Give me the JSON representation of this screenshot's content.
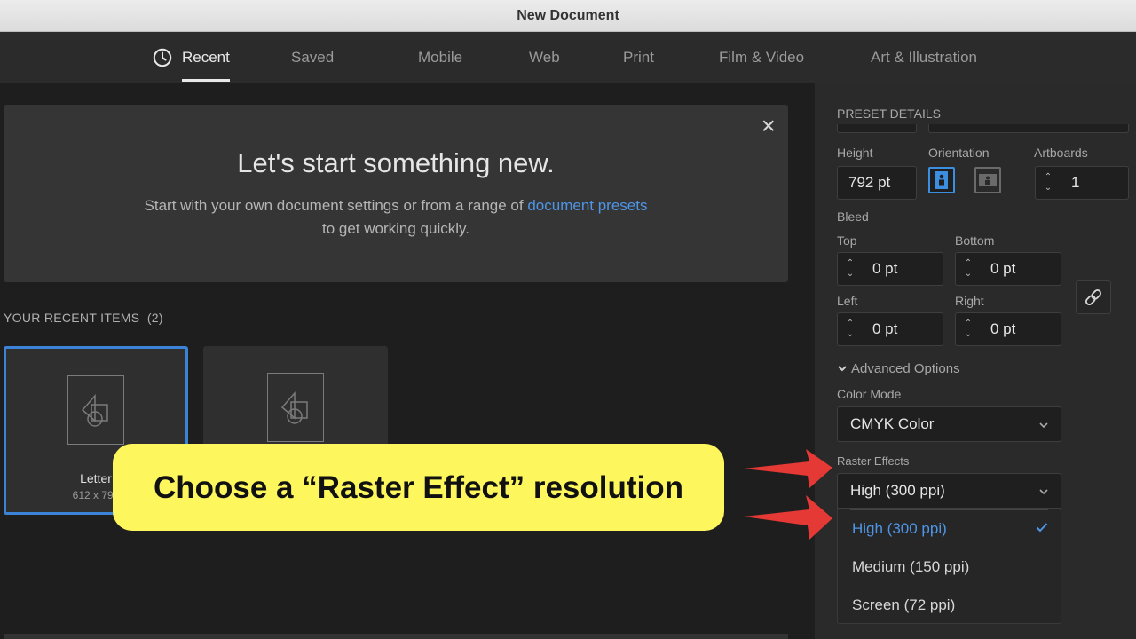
{
  "window": {
    "title": "New Document"
  },
  "tabs": [
    {
      "label": "Recent",
      "active": true,
      "icon": "clock-icon"
    },
    {
      "label": "Saved"
    },
    {
      "label": "Mobile"
    },
    {
      "label": "Web"
    },
    {
      "label": "Print"
    },
    {
      "label": "Film & Video"
    },
    {
      "label": "Art & Illustration"
    }
  ],
  "hero": {
    "title": "Let's start something new.",
    "subtitle_prefix": "Start with your own document settings or from a range of",
    "subtitle_link": "document presets",
    "subtitle_suffix": "to get working quickly.",
    "close_icon": "×"
  },
  "recent": {
    "title": "YOUR RECENT ITEMS",
    "count": "(2)",
    "items": [
      {
        "name": "Letter",
        "size": "612 x 792",
        "selected": true
      },
      {
        "name": "",
        "size": ""
      }
    ]
  },
  "preset": {
    "header": "PRESET DETAILS",
    "height_label": "Height",
    "height_value": "792 pt",
    "orientation_label": "Orientation",
    "artboards_label": "Artboards",
    "artboards_value": "1",
    "bleed_label": "Bleed",
    "top_label": "Top",
    "top_value": "0 pt",
    "bottom_label": "Bottom",
    "bottom_value": "0 pt",
    "left_label": "Left",
    "left_value": "0 pt",
    "right_label": "Right",
    "right_value": "0 pt",
    "advanced_label": "Advanced Options",
    "color_mode_label": "Color Mode",
    "color_mode_value": "CMYK Color",
    "raster_label": "Raster Effects",
    "raster_value": "High (300 ppi)",
    "raster_options": [
      "High (300 ppi)",
      "Medium (150 ppi)",
      "Screen (72 ppi)"
    ],
    "raster_selected": "High (300 ppi)"
  },
  "callout": {
    "text": "Choose a “Raster Effect” resolution"
  },
  "colors": {
    "accent": "#4f95e6",
    "callout": "#fdf65c",
    "arrow": "#e53935"
  }
}
